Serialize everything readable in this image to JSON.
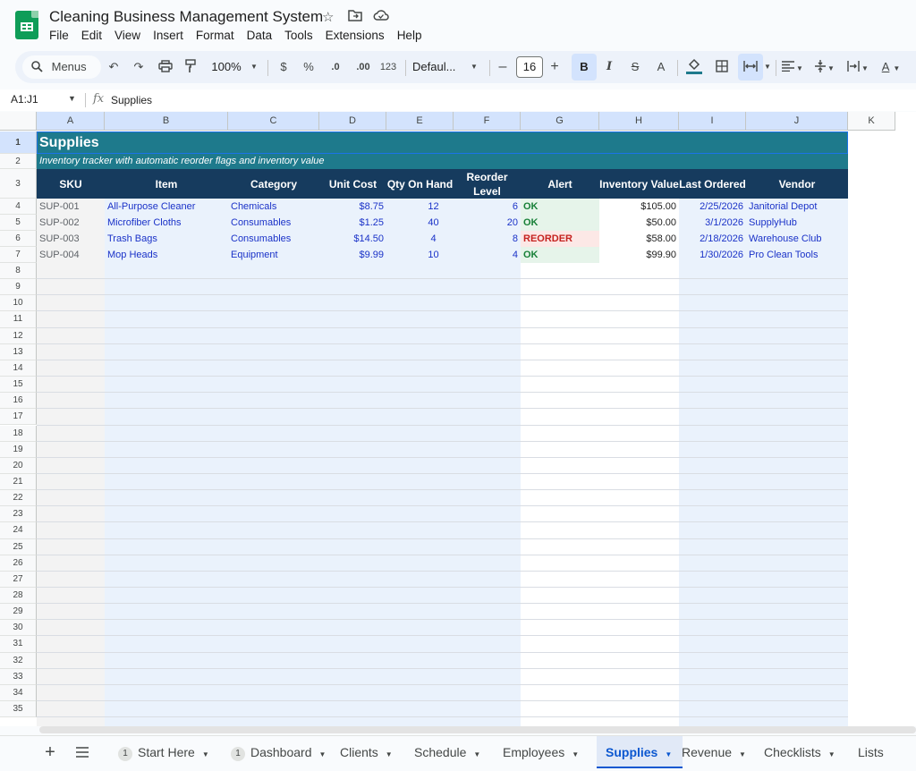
{
  "app": {
    "title": "Cleaning Business Management System",
    "menu": [
      "File",
      "Edit",
      "View",
      "Insert",
      "Format",
      "Data",
      "Tools",
      "Extensions",
      "Help"
    ]
  },
  "toolbar": {
    "menus_label": "Menus",
    "zoom": "100%",
    "currency": "$",
    "percent": "%",
    "dec_decrease": ".0",
    "dec_increase": ".00",
    "number_format": "123",
    "font": "Defaul...",
    "font_size": "16",
    "minus": "–",
    "plus": "+",
    "bold": "B",
    "italic": "I",
    "text_color": "A"
  },
  "formula_bar": {
    "name_box": "A1:J1",
    "fx": "fx",
    "content": "Supplies"
  },
  "columns": [
    "A",
    "B",
    "C",
    "D",
    "E",
    "F",
    "G",
    "H",
    "I",
    "J",
    "K"
  ],
  "sheet": {
    "title": "Supplies",
    "subtitle": "Inventory tracker with automatic reorder flags and inventory value",
    "headers": [
      "SKU",
      "Item",
      "Category",
      "Unit Cost",
      "Qty On Hand",
      "Reorder Level",
      "Alert",
      "Inventory Value",
      "Last Ordered",
      "Vendor"
    ],
    "rows": [
      {
        "sku": "SUP-001",
        "item": "All-Purpose Cleaner",
        "category": "Chemicals",
        "unit_cost": "$8.75",
        "qty": "12",
        "reorder": "6",
        "alert": "OK",
        "value": "$105.00",
        "last": "2/25/2026",
        "vendor": "Janitorial Depot"
      },
      {
        "sku": "SUP-002",
        "item": "Microfiber Cloths",
        "category": "Consumables",
        "unit_cost": "$1.25",
        "qty": "40",
        "reorder": "20",
        "alert": "OK",
        "value": "$50.00",
        "last": "3/1/2026",
        "vendor": "SupplyHub"
      },
      {
        "sku": "SUP-003",
        "item": "Trash Bags",
        "category": "Consumables",
        "unit_cost": "$14.50",
        "qty": "4",
        "reorder": "8",
        "alert": "REORDER",
        "value": "$58.00",
        "last": "2/18/2026",
        "vendor": "Warehouse Club"
      },
      {
        "sku": "SUP-004",
        "item": "Mop Heads",
        "category": "Equipment",
        "unit_cost": "$9.99",
        "qty": "10",
        "reorder": "4",
        "alert": "OK",
        "value": "$99.90",
        "last": "1/30/2026",
        "vendor": "Pro Clean Tools"
      }
    ],
    "row_numbers": [
      "1",
      "2",
      "3",
      "4",
      "5",
      "6",
      "7",
      "8",
      "9",
      "10",
      "11",
      "12",
      "13",
      "14",
      "15",
      "16",
      "17",
      "18",
      "19",
      "20",
      "21",
      "22",
      "23",
      "24",
      "25",
      "26",
      "27",
      "28",
      "29",
      "30",
      "31",
      "32",
      "33",
      "34",
      "35"
    ]
  },
  "tabs": [
    {
      "label": "Start Here",
      "badge": "1"
    },
    {
      "label": "Dashboard",
      "badge": "1"
    },
    {
      "label": "Clients"
    },
    {
      "label": "Schedule"
    },
    {
      "label": "Employees"
    },
    {
      "label": "Supplies",
      "active": true
    },
    {
      "label": "Revenue"
    },
    {
      "label": "Checklists"
    },
    {
      "label": "Lists"
    }
  ],
  "colors": {
    "title_bg": "#1e7a8c",
    "header_bg": "#163b5e",
    "input_blue": "#1a32c8",
    "ok_green": "#188038",
    "reorder_red": "#c5221f",
    "input_band": "#eaf2fc"
  }
}
